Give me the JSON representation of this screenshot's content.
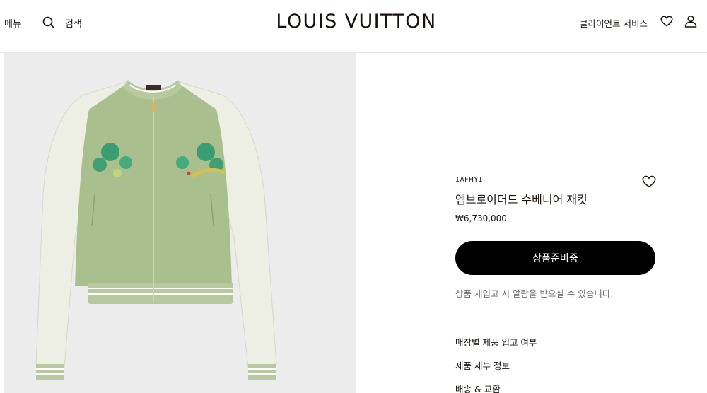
{
  "header": {
    "menu_label": "메뉴",
    "search_label": "검색",
    "logo_text": "LOUIS VUITTON",
    "client_service_label": "클라이언트 서비스",
    "icons": [
      "search-icon",
      "heart-icon",
      "user-icon"
    ]
  },
  "product": {
    "sku": "1AFHY1",
    "name": "엠브로이더드 수베니어 재킷",
    "price": "₩6,730,000",
    "cta_label": "상품준비중",
    "restock_note": "상품 재입고 시 알람을 받으실 수 있습니다.",
    "colors": {
      "cta_bg": "#000000",
      "jacket_body": "#a9c08e",
      "sleeves": "#eeefe4",
      "accent_crystals": "#2f9a6f"
    }
  },
  "info_links": [
    {
      "label": "매장별 제품 입고 여부"
    },
    {
      "label": "제품 세부 정보"
    },
    {
      "label": "배송 & 교환"
    }
  ]
}
